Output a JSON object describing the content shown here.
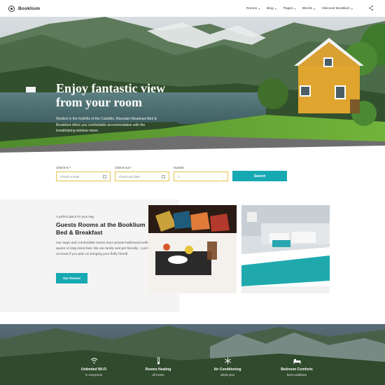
{
  "header": {
    "logo_text": "Booklium",
    "nav": [
      {
        "label": "Rooms"
      },
      {
        "label": "Blog"
      },
      {
        "label": "Pages"
      },
      {
        "label": "Blocks"
      },
      {
        "label": "Discover Booklium"
      }
    ]
  },
  "hero": {
    "title": "Enjoy fantastic view from your room",
    "text": "Nestled in the foothills of the Catskills, Mountain Meadows Bed & Breakfast offers you comfortable accommodation with the breathtaking window views."
  },
  "booking": {
    "checkin_label": "Check-in *",
    "checkin_placeholder": "Check-in Date",
    "checkout_label": "Check-out *",
    "checkout_placeholder": "Check-out Date",
    "guests_label": "Guests",
    "guests_value": "1",
    "search_label": "Search"
  },
  "rooms": {
    "eyebrow": "A perfect place for your stay",
    "title": "Guests Rooms at the Booklium Bed & Breakfast",
    "text": "Our large and comfortable rooms have private bathrooms with a queen or king sized bed. We are family and pet friendly – just let us know if you plan on bringing your fluffy friend!",
    "button_label": "Our Rooms"
  },
  "amenities": [
    {
      "title": "Unlimited Wi-Fi",
      "subtitle": "in everyroom"
    },
    {
      "title": "Rooms Heating",
      "subtitle": "all rooms"
    },
    {
      "title": "Air Conditioning",
      "subtitle": "whole year"
    },
    {
      "title": "Bedroom Comforts",
      "subtitle": "best conditions"
    }
  ],
  "colors": {
    "accent": "#17a9b1",
    "field_border": "#e3c548"
  }
}
